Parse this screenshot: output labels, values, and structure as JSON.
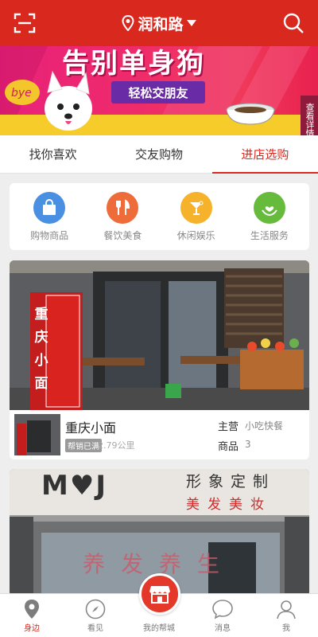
{
  "header": {
    "location": "润和路",
    "scan_icon": "scan-icon",
    "search_icon": "search-icon",
    "bg_color": "#d9291f"
  },
  "banner": {
    "title": "告别单身狗",
    "subtitle": "轻松交朋友",
    "side_tab": "查看详情",
    "bye_text": "bye"
  },
  "tabs": [
    {
      "label": "找你喜欢",
      "active": false
    },
    {
      "label": "交友购物",
      "active": false
    },
    {
      "label": "进店选购",
      "active": true
    }
  ],
  "categories": [
    {
      "label": "购物商品",
      "icon": "shopping-bag-icon",
      "color": "#4a90e2"
    },
    {
      "label": "餐饮美食",
      "icon": "fork-knife-icon",
      "color": "#ee6b3a"
    },
    {
      "label": "休闲娱乐",
      "icon": "cocktail-icon",
      "color": "#f6b22b"
    },
    {
      "label": "生活服务",
      "icon": "hand-heart-icon",
      "color": "#66bb3c"
    }
  ],
  "shops": [
    {
      "name": "重庆小面",
      "badge": "帮销已满",
      "distance": "2.79公里",
      "main_label": "主营",
      "main_value": "小吃快餐",
      "goods_label": "商品",
      "goods_value": "3",
      "sign_text": "重庆小面"
    },
    {
      "sign_brand": "M♥J",
      "sign_line1": "形象定制",
      "sign_line2": "美发美妆",
      "sign_line3": "养发养生"
    }
  ],
  "nav": [
    {
      "label": "身边",
      "icon": "location-pin-icon",
      "active": true
    },
    {
      "label": "看见",
      "icon": "compass-icon",
      "active": false
    },
    {
      "label": "我的帮城",
      "icon": "storefront-icon",
      "active": false
    },
    {
      "label": "消息",
      "icon": "chat-bubble-icon",
      "active": false
    },
    {
      "label": "我",
      "icon": "user-icon",
      "active": false
    }
  ]
}
